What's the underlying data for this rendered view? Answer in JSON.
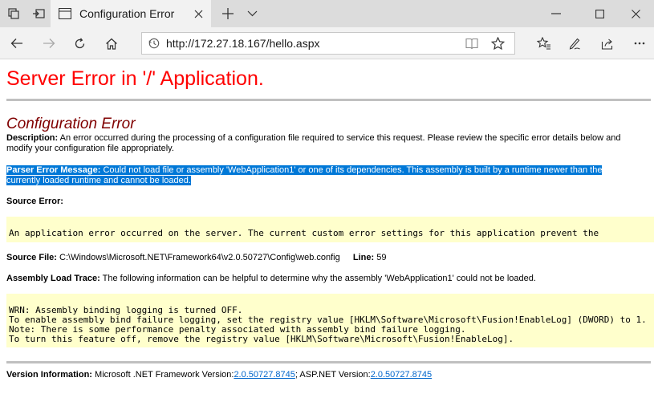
{
  "browser": {
    "tab_title": "Configuration Error",
    "url": "http://172.27.18.167/hello.aspx"
  },
  "page": {
    "heading": "Server Error in '/' Application.",
    "subheading": "Configuration Error",
    "description_label": "Description:",
    "description_text": "An error occurred during the processing of a configuration file required to service this request. Please review the specific error details below and modify your configuration file appropriately.",
    "parser_label": "Parser Error Message:",
    "parser_text_line1": "Could not load file or assembly 'WebApplication1' or one of its dependencies. This assembly is built by a runtime newer than the",
    "parser_text_line2": "currently loaded runtime and cannot be loaded.",
    "source_error_label": "Source Error:",
    "source_error_text": "An application error occurred on the server. The current custom error settings for this application prevent the",
    "source_file_label": "Source File:",
    "source_file_path": "C:\\Windows\\Microsoft.NET\\Framework64\\v2.0.50727\\Config\\web.config",
    "line_label": "Line:",
    "line_value": "59",
    "assembly_trace_label": "Assembly Load Trace:",
    "assembly_trace_text": "The following information can be helpful to determine why the assembly 'WebApplication1' could not be loaded.",
    "trace_lines": [
      "WRN: Assembly binding logging is turned OFF.",
      "To enable assembly bind failure logging, set the registry value [HKLM\\Software\\Microsoft\\Fusion!EnableLog] (DWORD) to 1.",
      "Note: There is some performance penalty associated with assembly bind failure logging.",
      "To turn this feature off, remove the registry value [HKLM\\Software\\Microsoft\\Fusion!EnableLog]."
    ],
    "version_label": "Version Information:",
    "framework_text": "Microsoft .NET Framework Version:",
    "framework_version": "2.0.50727.8745",
    "separator": ";",
    "aspnet_text": "ASP.NET Version:",
    "aspnet_version": "2.0.50727.8745"
  }
}
